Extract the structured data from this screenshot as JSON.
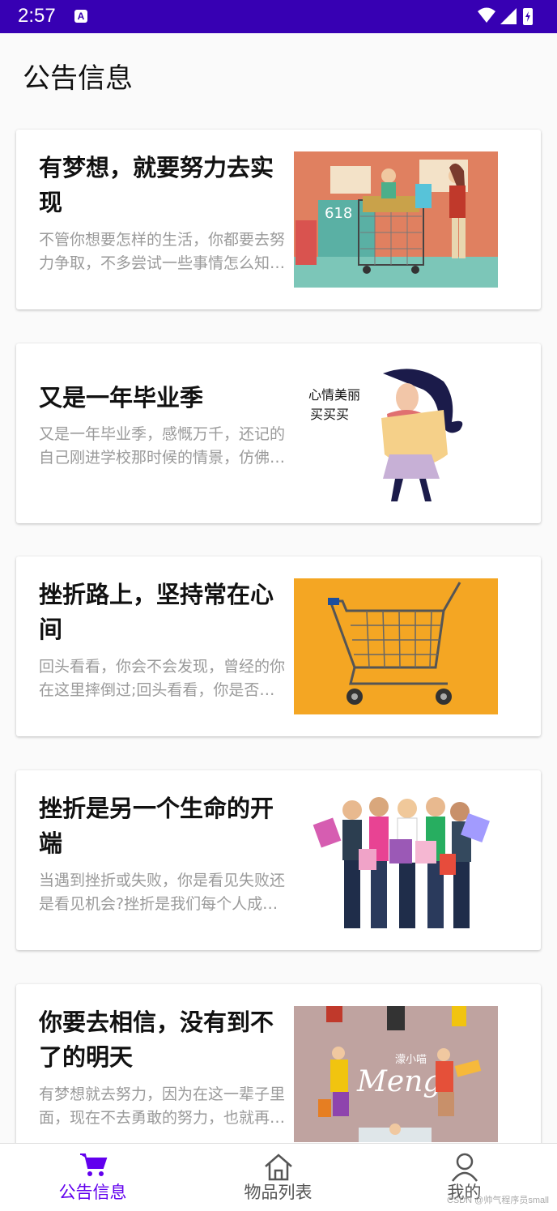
{
  "status_bar": {
    "time": "2:57",
    "app_badge": "A"
  },
  "header": {
    "title": "公告信息"
  },
  "notices": [
    {
      "title": "有梦想，就要努力去实现",
      "desc": "不管你想要怎样的生活，你都要去努力争取，不多尝试一些事情怎么知道自己适合什么。",
      "image": "shopping-cart-illustration"
    },
    {
      "title": "又是一年毕业季",
      "desc": "又是一年毕业季，感慨万千，还记的自己刚进学校那时候的情景，仿佛就在昨天。",
      "image": "girl-with-bag-illustration",
      "image_text": [
        "心情美丽",
        "买买买"
      ]
    },
    {
      "title": "挫折路上，坚持常在心间",
      "desc": "回头看看，你会不会发现，曾经的你在这里摔倒过;回头看看，你是否发现，一次次的困难。",
      "image": "shopping-cart-photo"
    },
    {
      "title": "挫折是另一个生命的开端",
      "desc": "当遇到挫折或失败，你是看见失败还是看见机会?挫折是我们每个人成长的必经之路。",
      "image": "women-with-shopping-bags-photo"
    },
    {
      "title": "你要去相信，没有到不了的明天",
      "desc": "有梦想就去努力，因为在这一辈子里面，现在不去勇敢的努力，也就再也没有机会了。",
      "image": "fashion-girls-illustration",
      "image_text": [
        "濛小喵",
        "Meng"
      ]
    }
  ],
  "tabs": [
    {
      "label": "公告信息",
      "icon": "cart-icon",
      "active": true
    },
    {
      "label": "物品列表",
      "icon": "home-icon",
      "active": false
    },
    {
      "label": "我的",
      "icon": "person-icon",
      "active": false
    }
  ],
  "watermark": "CSDN @帅气程序员small",
  "colors": {
    "primary": "#6200ee",
    "status_bar": "#3700b3"
  }
}
